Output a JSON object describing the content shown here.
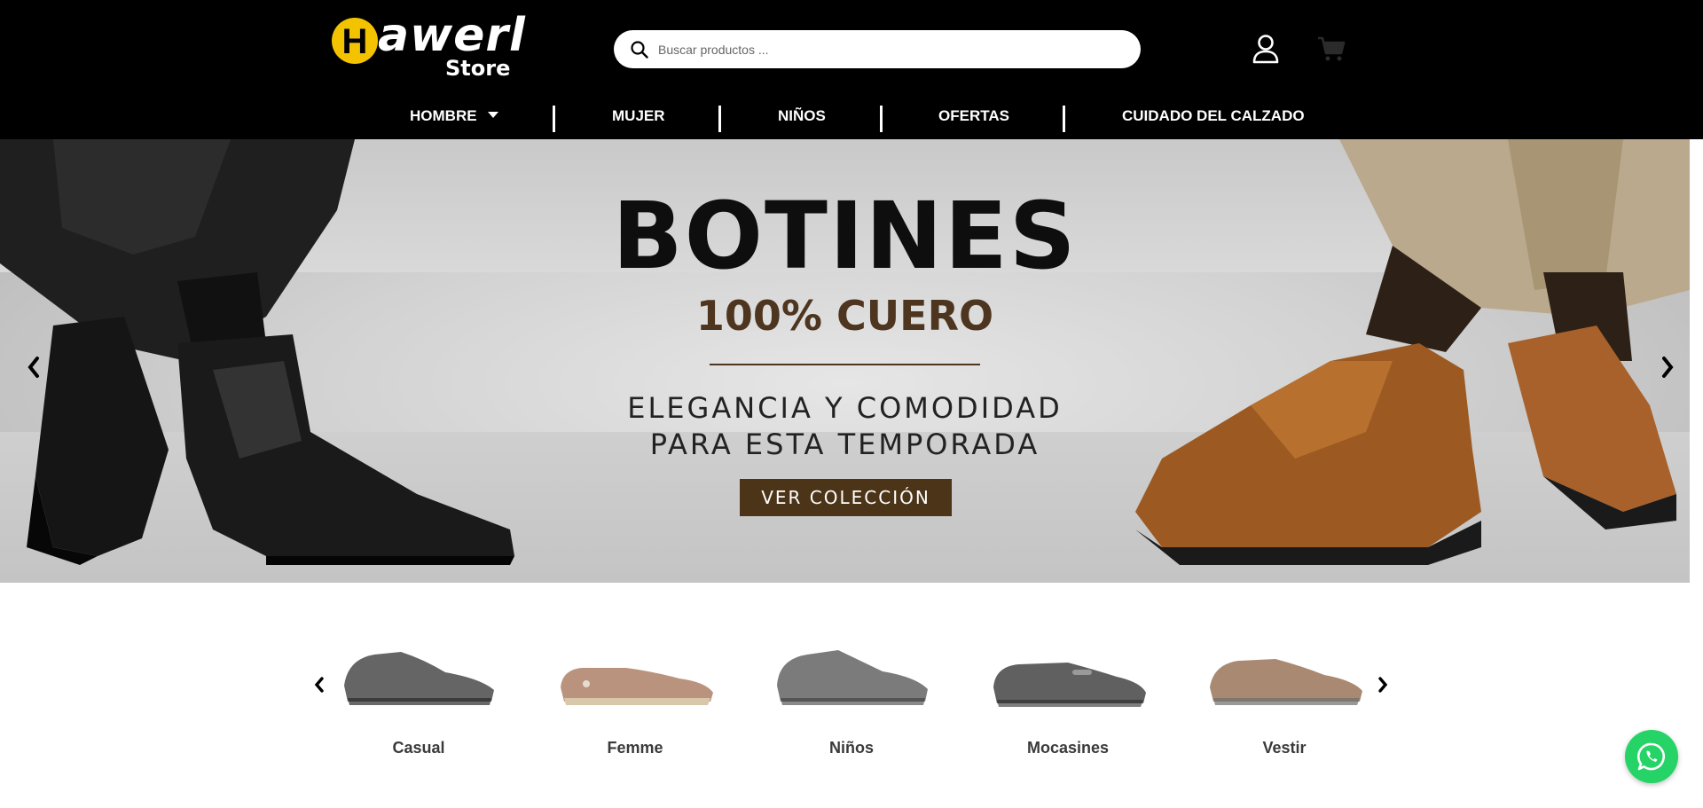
{
  "brand": {
    "name": "awerl",
    "initial": "H",
    "sub": "Store",
    "accent": "#f3c300"
  },
  "search": {
    "placeholder": "Buscar productos ..."
  },
  "icons": {
    "search": "search-icon",
    "user": "user-icon",
    "cart": "cart-icon",
    "whatsapp": "whatsapp-icon"
  },
  "nav": {
    "items": [
      {
        "label": "HOMBRE",
        "has_dropdown": true
      },
      {
        "label": "MUJER"
      },
      {
        "label": "NIÑOS"
      },
      {
        "label": "OFERTAS"
      },
      {
        "label": "CUIDADO DEL CALZADO"
      }
    ]
  },
  "hero": {
    "title": "BOTINES",
    "subtitle": "100% CUERO",
    "tagline_1": "ELEGANCIA Y COMODIDAD",
    "tagline_2": "PARA ESTA TEMPORADA",
    "button": "VER COLECCIÓN",
    "button_color": "#4b3418"
  },
  "categories": {
    "items": [
      {
        "label": "Casual",
        "color": "#4a4a4a"
      },
      {
        "label": "Femme",
        "color": "#b38770"
      },
      {
        "label": "Niños",
        "color": "#5a5a5a"
      },
      {
        "label": "Mocasines",
        "color": "#444444"
      },
      {
        "label": "Vestir",
        "color": "#a07c62"
      }
    ]
  }
}
